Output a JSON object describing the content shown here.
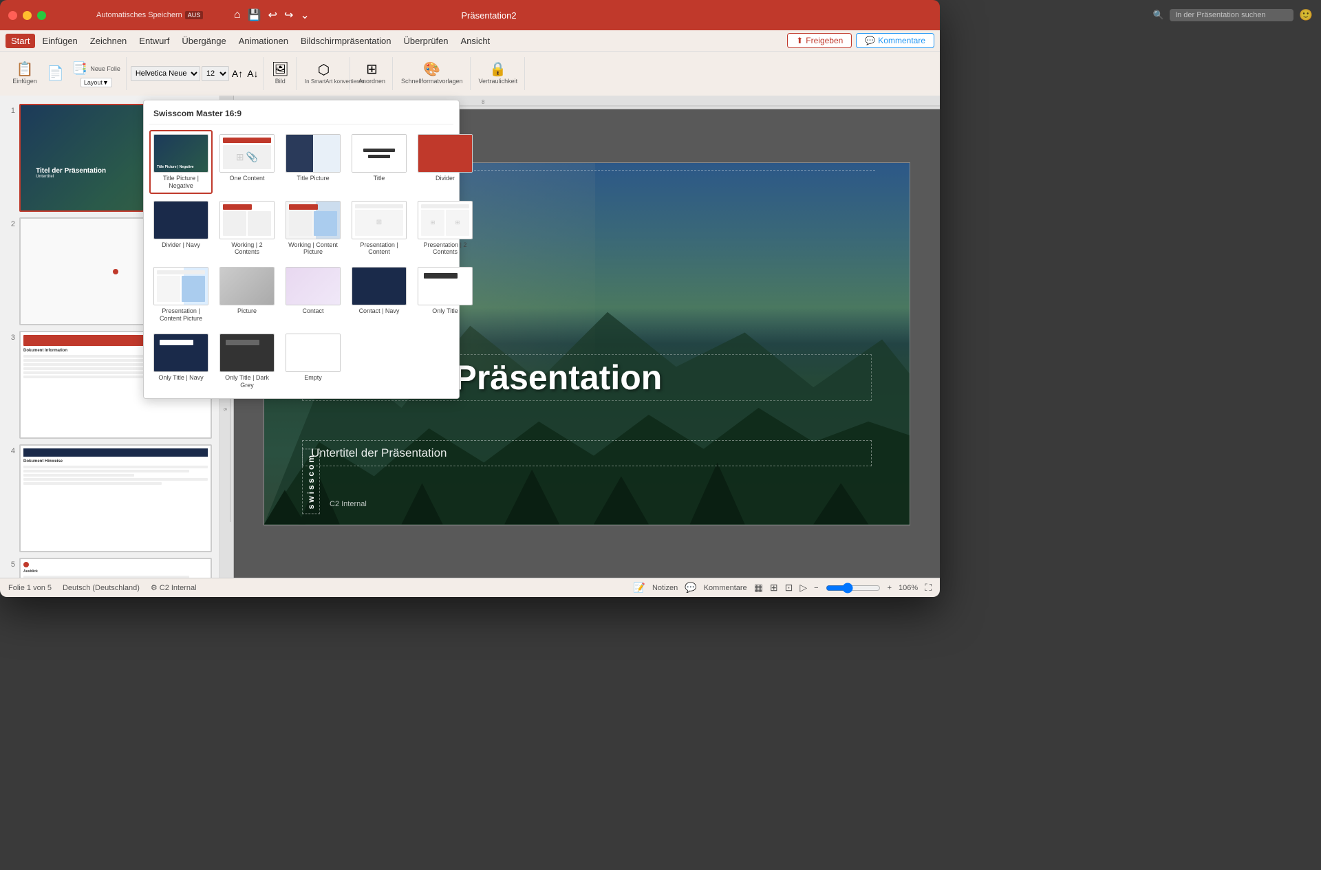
{
  "window": {
    "title": "Präsentation2",
    "auto_save_label": "Automatisches Speichern",
    "auto_badge": "AUS"
  },
  "menu": {
    "items": [
      {
        "id": "start",
        "label": "Start",
        "active": true
      },
      {
        "id": "einfuegen",
        "label": "Einfügen"
      },
      {
        "id": "zeichnen",
        "label": "Zeichnen"
      },
      {
        "id": "entwurf",
        "label": "Entwurf"
      },
      {
        "id": "uebergaenge",
        "label": "Übergänge"
      },
      {
        "id": "animationen",
        "label": "Animationen"
      },
      {
        "id": "bildschirm",
        "label": "Bildschirmpräsentation"
      },
      {
        "id": "ueberpruefen",
        "label": "Überprüfen"
      },
      {
        "id": "ansicht",
        "label": "Ansicht"
      }
    ],
    "share_label": "Freigeben",
    "comment_label": "Kommentare"
  },
  "toolbar": {
    "new_slide_label": "Neue\nFolie",
    "insert_label": "Einfügen",
    "bild_label": "Bild",
    "anordnen_label": "Anordnen",
    "schnellformat_label": "Schnellformatvorlagen",
    "vertraulich_label": "Vertraulichkeit",
    "smartart_label": "In SmartArt\nkonvertieren"
  },
  "layout_dropdown": {
    "header": "Swisscom Master 16:9",
    "layouts": [
      {
        "id": "title-pic-neg",
        "label": "Title Picture | Negative",
        "selected": true
      },
      {
        "id": "one-content",
        "label": "One Content"
      },
      {
        "id": "title-pic",
        "label": "Title Picture"
      },
      {
        "id": "title",
        "label": "Title"
      },
      {
        "id": "divider",
        "label": "Divider"
      },
      {
        "id": "divider-navy",
        "label": "Divider | Navy"
      },
      {
        "id": "working-2cont",
        "label": "Working | 2 Contents"
      },
      {
        "id": "working-cont-pic",
        "label": "Working | Content Picture"
      },
      {
        "id": "pres-content",
        "label": "Presentation | Content"
      },
      {
        "id": "pres-2cont",
        "label": "Presentation | 2 Contents"
      },
      {
        "id": "pres-cont-pic",
        "label": "Presentation | Content Picture"
      },
      {
        "id": "picture",
        "label": "Picture"
      },
      {
        "id": "contact",
        "label": "Contact"
      },
      {
        "id": "contact-navy",
        "label": "Contact | Navy"
      },
      {
        "id": "only-title",
        "label": "Only Title"
      },
      {
        "id": "only-title-navy",
        "label": "Only Title | Navy"
      },
      {
        "id": "only-title-dg",
        "label": "Only Title | Dark Grey"
      },
      {
        "id": "empty",
        "label": "Empty"
      }
    ]
  },
  "slides": [
    {
      "num": "1",
      "active": true
    },
    {
      "num": "2",
      "active": false
    },
    {
      "num": "3",
      "active": false
    },
    {
      "num": "4",
      "active": false
    },
    {
      "num": "5",
      "active": false
    }
  ],
  "main_slide": {
    "title": "Titel der Präsentation",
    "subtitle": "Untertitel der Präsentation",
    "logo": "swisscom",
    "classification": "C2 Internal"
  },
  "status_bar": {
    "slide_info": "Folie 1 von 5",
    "language": "Deutsch (Deutschland)",
    "classification": "C2 Internal",
    "notes_label": "Notizen",
    "comments_label": "Kommentare",
    "zoom": "106%"
  }
}
